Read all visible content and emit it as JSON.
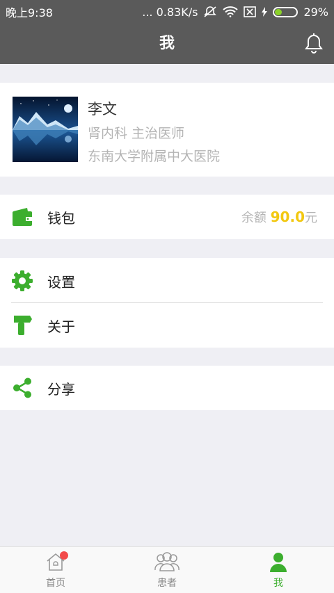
{
  "status_bar": {
    "time": "晚上9:38",
    "net_speed": "... 0.83K/s",
    "battery_pct": "29%"
  },
  "header": {
    "title": "我"
  },
  "profile": {
    "name": "李文",
    "department_title": "肾内科  主治医师",
    "hospital": "东南大学附属中大医院"
  },
  "wallet": {
    "label": "钱包",
    "balance_prefix": "余额",
    "balance_amount": "90.0",
    "balance_unit": "元"
  },
  "menu": {
    "settings": "设置",
    "about": "关于",
    "share": "分享"
  },
  "tabs": [
    {
      "label": "首页"
    },
    {
      "label": "患者"
    },
    {
      "label": "我"
    }
  ],
  "colors": {
    "accent": "#3cae2e",
    "header": "#5a5a5a",
    "amount": "#f2c811"
  }
}
